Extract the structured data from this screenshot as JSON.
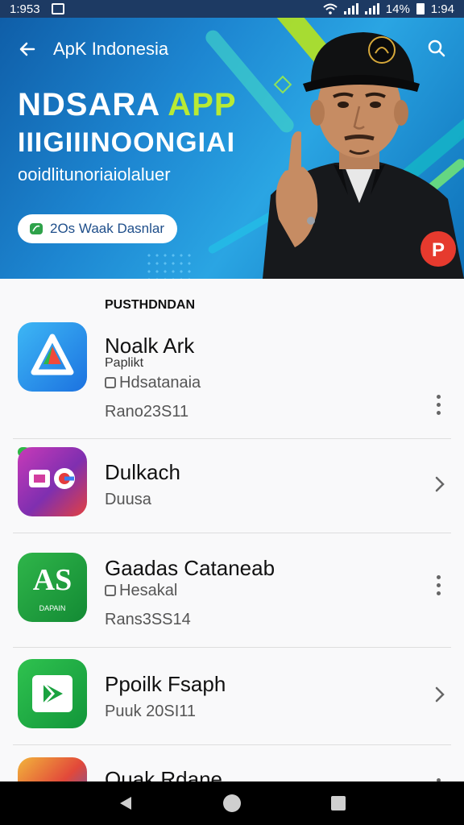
{
  "status_bar": {
    "time_left": "1:953",
    "battery": "14%",
    "time_right": "1:94"
  },
  "header": {
    "title": "ApK Indonesia"
  },
  "hero": {
    "title_main": "NDSARA ",
    "title_accent": "APP",
    "subtitle": "IIIGIIINOONGIAI",
    "tagline": "ooidlitunoriaiolaluer",
    "pill_label": "2Os Waak Dasnlar",
    "accent_color": "#b8ea34"
  },
  "list": {
    "section_title": "PUSTHDNDAN",
    "items": [
      {
        "name": "Noalk Ark",
        "line1": "Paplikt",
        "line2": "Hdsatanaia",
        "line3": "Rano23S11",
        "action": "more-vert"
      },
      {
        "name": "Dulkach",
        "line1": "Duusa",
        "action": "chevron-right"
      },
      {
        "name": "Gaadas Cataneab",
        "line1": "Hesakal",
        "line2": "Rans3SS14",
        "icon_text": "AS",
        "icon_caption": "DAPAIN",
        "action": "more-vert"
      },
      {
        "name": "Ppoilk Fsaph",
        "line1": "Puuk 20SI11",
        "action": "chevron-right"
      },
      {
        "name": "Ouak Rdane",
        "action": "more-vert"
      }
    ]
  }
}
